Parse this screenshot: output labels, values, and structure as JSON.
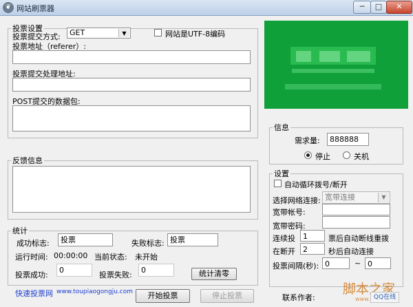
{
  "window": {
    "title": "网站刷票器",
    "icon": "app-icon",
    "minimize": "─",
    "restore": "□",
    "close": "✕"
  },
  "vote_settings": {
    "legend": "投票设置",
    "method_label": "投票提交方式:",
    "method_value": "GET",
    "utf8_label": "网站是UTF-8编码",
    "utf8_checked": false,
    "url_label": "投票地址（referer）:",
    "url_value": "",
    "handler_label": "投票提交处理地址:",
    "handler_value": "",
    "post_label": "POST提交的数据包:",
    "post_value": ""
  },
  "feedback": {
    "legend": "反馈信息",
    "value": ""
  },
  "stats": {
    "legend": "统计",
    "success_flag_label": "成功标志:",
    "success_flag_value": "投票",
    "fail_flag_label": "失败标志:",
    "fail_flag_value": "投票",
    "runtime_label": "运行时间:",
    "runtime_value": "00:00:00",
    "status_label": "当前状态:",
    "status_value": "未开始",
    "vote_success_label": "投票成功:",
    "vote_success_value": "0",
    "vote_fail_label": "投票失败:",
    "vote_fail_value": "0",
    "clear_button": "统计清零"
  },
  "info": {
    "legend": "信息",
    "demand_label": "需求量:",
    "demand_value": "888888",
    "stop_label": "停止",
    "shutdown_label": "关机",
    "selected": "stop"
  },
  "settings": {
    "legend": "设置",
    "auto_redial_label": "自动循环拨号/断开",
    "auto_redial_checked": false,
    "connection_label": "选择网络连接:",
    "connection_value": "宽带连接",
    "account_label": "宽带帐号:",
    "account_value": "",
    "password_label": "宽带密码:",
    "password_value": "",
    "connect_label": "连续投",
    "connect_value": "1",
    "connect_suffix": "票后自动断线重拨",
    "disconnect_label": "在断开",
    "disconnect_value": "2",
    "disconnect_suffix": "秒后自动连接",
    "interval_label": "投票间隔(秒):",
    "interval_from": "0",
    "interval_to": "0",
    "interval_sep": "~"
  },
  "footer": {
    "site_name": "快速投票网",
    "site_url": "www.toupiaogongju.com",
    "start_button": "开始投票",
    "stop_button": "停止投票",
    "contact_label": "联系作者:"
  },
  "watermark": {
    "text": "脚本之家",
    "url": "www.jb51.net",
    "qq": "QQ在线"
  },
  "colors": {
    "ad_green": "#0fa03a",
    "link_blue": "#1c3ecc"
  }
}
